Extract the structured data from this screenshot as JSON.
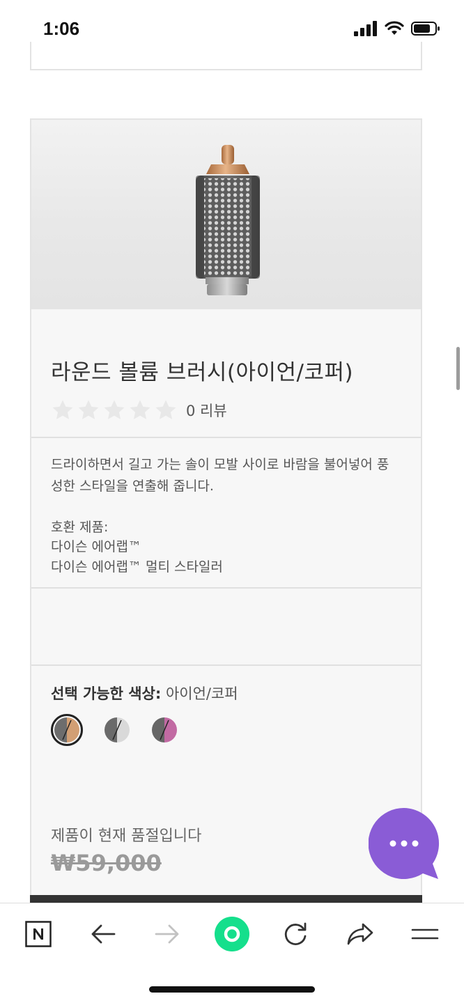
{
  "status_bar": {
    "time": "1:06"
  },
  "product": {
    "title": "라운드 볼륨 브러시(아이언/코퍼)",
    "rating_stars": 0,
    "review_count": "0 리뷰",
    "description": "드라이하면서 길고 가는 솔이 모발 사이로 바람을 불어넣어 풍성한 스타일을 연출해 줍니다.",
    "compat_label": "호환 제품:",
    "compatible": [
      "다이슨 에어랩™",
      "다이슨 에어랩™ 멀티 스타일러"
    ],
    "color_label": "선택 가능한 색상:",
    "selected_color": "아이언/코퍼",
    "swatches": [
      {
        "name": "iron-copper",
        "left": "#6d6d6d",
        "right": "#d29f74",
        "selected": true
      },
      {
        "name": "iron-silver",
        "left": "#6a6a6a",
        "right": "#d9d9d9",
        "selected": false
      },
      {
        "name": "iron-fuchsia",
        "left": "#666666",
        "right": "#c26aa3",
        "selected": false
      }
    ],
    "stock_status": "제품이 현재 품절입니다",
    "price": "₩59,000"
  },
  "chat": {
    "icon": "chat-dots-icon",
    "color": "#8a5cd6"
  },
  "toolbar": {
    "items": [
      "naver-logo-icon",
      "back-arrow-icon",
      "forward-arrow-icon",
      "green-home-icon",
      "reload-icon",
      "share-icon",
      "menu-icon"
    ],
    "accent": "#15df8c"
  }
}
